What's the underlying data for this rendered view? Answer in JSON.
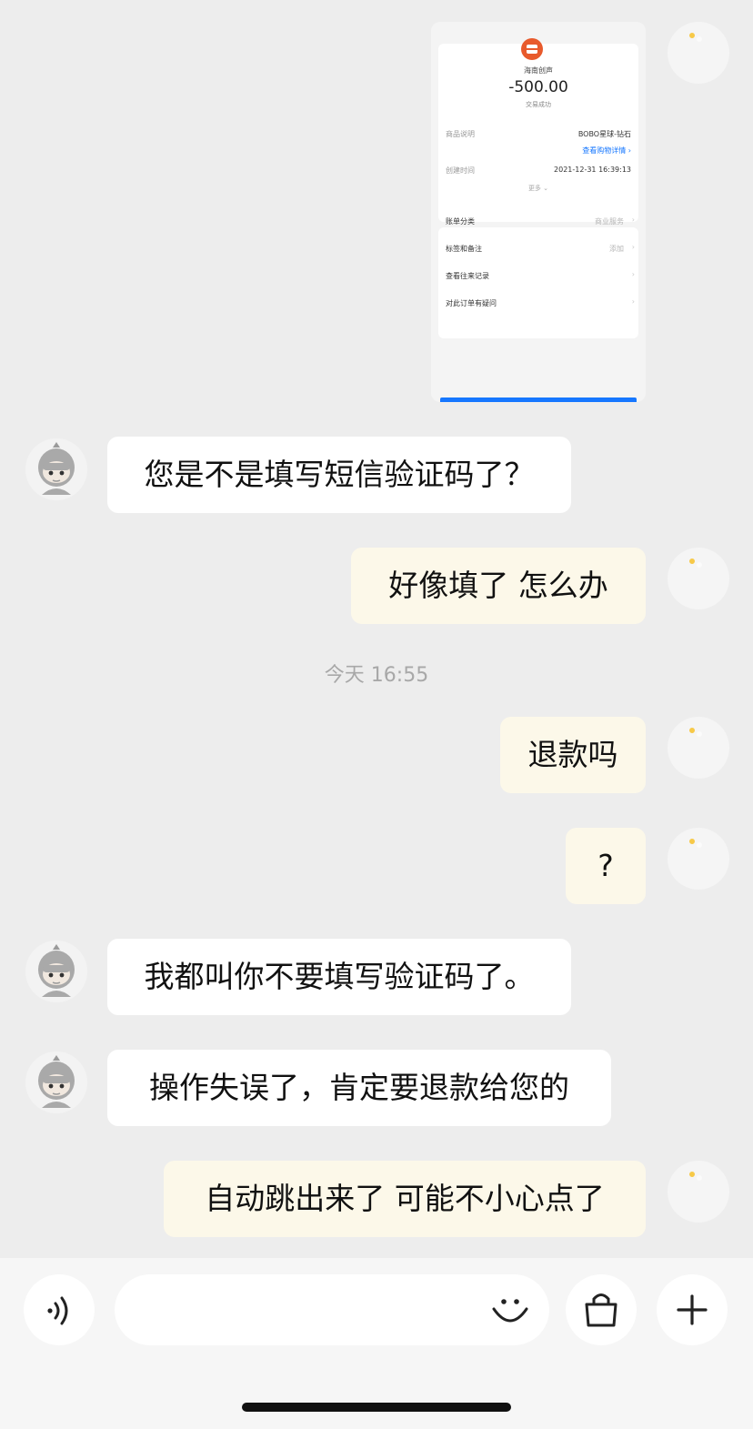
{
  "receipt": {
    "merchant": "海南创声",
    "amount": "-500.00",
    "status": "交易成功",
    "rows": [
      {
        "label": "商品说明",
        "value": "BOBO星球-钻石"
      },
      {
        "label": "创建时间",
        "value": "2021-12-31 16:39:13"
      }
    ],
    "link_text": "查看购物详情",
    "more_label": "更多",
    "list": [
      {
        "label": "账单分类",
        "value": "商业服务"
      },
      {
        "label": "标签和备注",
        "value": "添加"
      },
      {
        "label": "查看往来记录",
        "value": ""
      },
      {
        "label": "对此订单有疑问",
        "value": ""
      }
    ]
  },
  "messages": [
    {
      "from": "agent",
      "text": "您是不是填写短信验证码了？"
    },
    {
      "from": "me",
      "text": "好像填了  怎么办"
    },
    {
      "from": "me",
      "text": "退款吗"
    },
    {
      "from": "me",
      "text": "?"
    },
    {
      "from": "agent",
      "text": "我都叫你不要填写验证码了。"
    },
    {
      "from": "agent",
      "text": "操作失误了，肯定要退款给您的"
    },
    {
      "from": "me",
      "text": "自动跳出来了 可能不小心点了"
    }
  ],
  "timestamp": "今天 16:55",
  "toolbar": {
    "voice_icon": "voice-icon",
    "emoji_icon": "emoji-icon",
    "shop_icon": "shopping-bag-icon",
    "plus_icon": "plus-icon",
    "input_value": ""
  },
  "colors": {
    "background": "#ededed",
    "my_bubble": "#fcf8e9",
    "agent_bubble": "#ffffff",
    "link": "#1677ff",
    "merchant_logo": "#e85a2c"
  }
}
